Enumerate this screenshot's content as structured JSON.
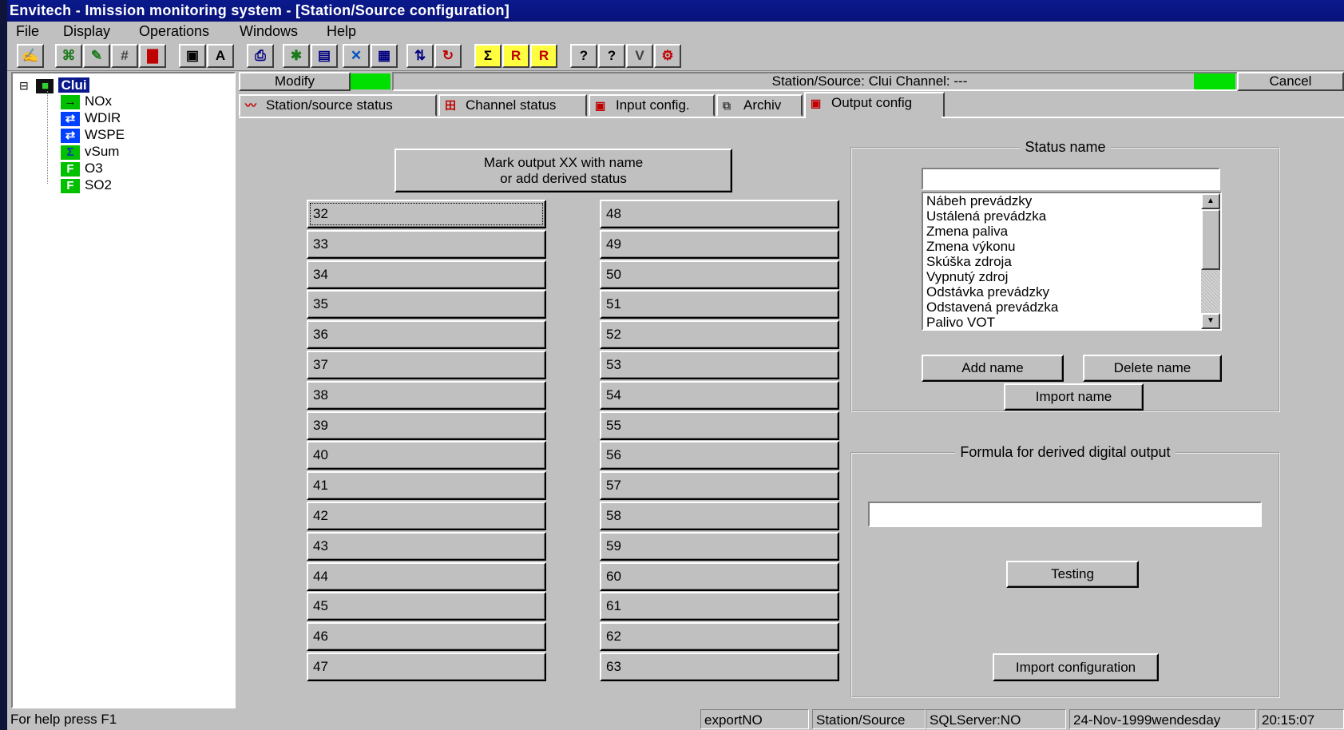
{
  "window": {
    "title": "Envitech - Imission  monitoring system - [Station/Source configuration]"
  },
  "menu": {
    "items": [
      "File",
      "Display",
      "Operations",
      "Windows",
      "Help"
    ]
  },
  "toolbar": {
    "icons": [
      "wrench-icon",
      "station-map-icon",
      "station-edit-icon",
      "grid-icon",
      "bar-chart-icon",
      "save-icon",
      "text-icon",
      "printer-icon",
      "settings-icon",
      "table-icon",
      "crosshair-icon",
      "grid-select-icon",
      "sort-icon",
      "refresh-icon",
      "sigma-icon",
      "r-icon",
      "r-cross-icon",
      "help-icon",
      "context-help-icon",
      "vari-icon",
      "tools-icon"
    ],
    "glyphs": [
      "✍",
      "⌘",
      "✎",
      "#",
      "▇",
      "▣",
      "A",
      "⎙",
      "✱",
      "▤",
      "✕",
      "▦",
      "⇅",
      "↻",
      "Σ",
      "R",
      "R",
      "?",
      "?",
      "V",
      "⚙"
    ]
  },
  "tree": {
    "root": {
      "label": "Clui",
      "expander": "⊟"
    },
    "channels": [
      {
        "label": "NOx",
        "icon": "→"
      },
      {
        "label": "WDIR",
        "icon": "⇄"
      },
      {
        "label": "WSPE",
        "icon": "⇄"
      },
      {
        "label": "vSum",
        "icon": "Σ"
      },
      {
        "label": "O3",
        "icon": "F"
      },
      {
        "label": "SO2",
        "icon": "F"
      }
    ]
  },
  "header": {
    "modify_label": "Modify",
    "status_text": "Station/Source: Clui   Channel: ---",
    "cancel_label": "Cancel",
    "indicator_color": "#00e000"
  },
  "tabs": [
    {
      "label": "Station/source status",
      "icon": "〰"
    },
    {
      "label": "Channel status",
      "icon": "田"
    },
    {
      "label": "Input config.",
      "icon": "▣"
    },
    {
      "label": "Archiv",
      "icon": "⧉"
    },
    {
      "label": "Output config",
      "icon": "▣"
    }
  ],
  "output_config": {
    "mark_button_line1": "Mark output XX with name",
    "mark_button_line2": "or add derived status",
    "left_outputs": [
      "32",
      "33",
      "34",
      "35",
      "36",
      "37",
      "38",
      "39",
      "40",
      "41",
      "42",
      "43",
      "44",
      "45",
      "46",
      "47"
    ],
    "right_outputs": [
      "48",
      "49",
      "50",
      "51",
      "52",
      "53",
      "54",
      "55",
      "56",
      "57",
      "58",
      "59",
      "60",
      "61",
      "62",
      "63"
    ],
    "status_group": {
      "legend": "Status name",
      "input_value": "",
      "list_items": [
        "Nábeh prevádzky",
        "Ustálená prevádzka",
        "Zmena paliva",
        "Zmena výkonu",
        "Skúška zdroja",
        "Vypnutý zdroj",
        "Odstávka prevádzky",
        "Odstavená prevádzka",
        "Palivo VOT"
      ],
      "add_label": "Add name",
      "delete_label": "Delete name",
      "import_label": "Import name"
    },
    "formula_group": {
      "legend": "Formula for derived digital output",
      "input_value": "",
      "testing_label": "Testing"
    },
    "import_config_label": "Import configuration"
  },
  "statusbar": {
    "help": "For help press F1",
    "export": "exportNO",
    "station": "Station/Source",
    "sql": "SQLServer:NO",
    "date": "24-Nov-1999wendesday",
    "time": "20:15:07"
  }
}
